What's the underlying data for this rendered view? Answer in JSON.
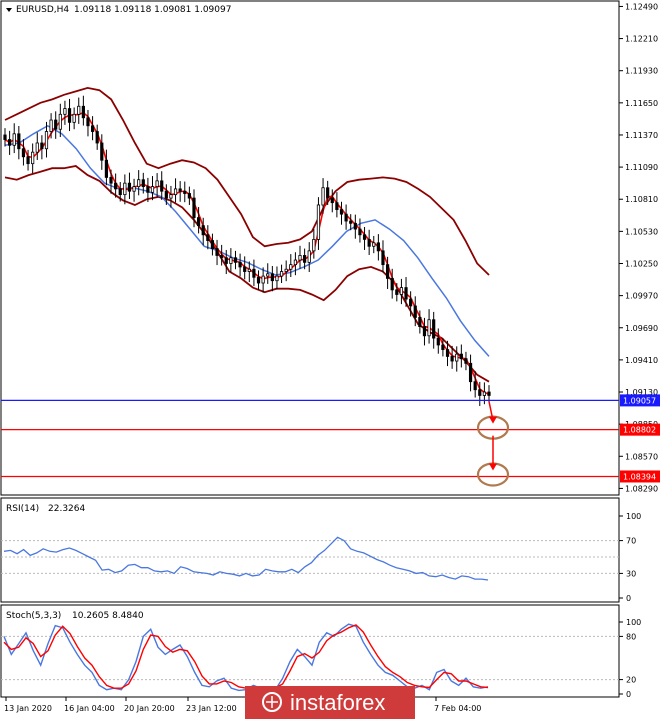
{
  "header": {
    "symbol": "EURUSD,H4",
    "ohlc": "1.09118 1.09118 1.09081 1.09097"
  },
  "chart_data": [
    {
      "type": "candlestick",
      "name": "price",
      "ylim": [
        1.0825,
        1.1252
      ],
      "y_ticks": [
        "1.12490",
        "1.12210",
        "1.11930",
        "1.11650",
        "1.11370",
        "1.11090",
        "1.10810",
        "1.10530",
        "1.10250",
        "1.09970",
        "1.09690",
        "1.09410",
        "1.09130",
        "1.08850",
        "1.08570",
        "1.08290"
      ],
      "y_tick_values": [
        1.1249,
        1.1221,
        1.1193,
        1.1165,
        1.1137,
        1.1109,
        1.1081,
        1.1053,
        1.1025,
        1.0997,
        1.0969,
        1.0941,
        1.0913,
        1.0885,
        1.0857,
        1.0829
      ],
      "close": [
        1.1133,
        1.1128,
        1.1138,
        1.1125,
        1.1118,
        1.1112,
        1.1122,
        1.113,
        1.1125,
        1.114,
        1.115,
        1.1142,
        1.1155,
        1.116,
        1.1148,
        1.1155,
        1.1162,
        1.1152,
        1.1145,
        1.114,
        1.113,
        1.1115,
        1.11,
        1.1095,
        1.109,
        1.1085,
        1.1095,
        1.1088,
        1.1092,
        1.1098,
        1.1092,
        1.1087,
        1.1092,
        1.1097,
        1.1088,
        1.1082,
        1.1085,
        1.109,
        1.1088,
        1.1086,
        1.1082,
        1.1065,
        1.1058,
        1.105,
        1.1045,
        1.1038,
        1.1032,
        1.103,
        1.1025,
        1.103,
        1.1026,
        1.1022,
        1.1018,
        1.102,
        1.1013,
        1.1008,
        1.1014,
        1.1016,
        1.101,
        1.1014,
        1.1018,
        1.102,
        1.1024,
        1.1028,
        1.1032,
        1.1026,
        1.1036,
        1.1046,
        1.1076,
        1.1091,
        1.1082,
        1.1078,
        1.1072,
        1.1068,
        1.1062,
        1.106,
        1.1055,
        1.105,
        1.1046,
        1.104,
        1.1043,
        1.1036,
        1.1024,
        1.1012,
        1.1002,
        1.0998,
        1.1004,
        1.0994,
        1.0988,
        1.0978,
        1.097,
        1.0962,
        1.0976,
        1.096,
        1.0954,
        1.095,
        1.0944,
        1.094,
        1.0946,
        1.0942,
        1.0938,
        1.0922,
        1.0915,
        1.091,
        1.0913,
        1.091
      ],
      "bollinger_upper": [
        1.115,
        1.1155,
        1.116,
        1.1165,
        1.1168,
        1.1172,
        1.1175,
        1.1178,
        1.1176,
        1.1168,
        1.115,
        1.113,
        1.1112,
        1.1108,
        1.1112,
        1.1115,
        1.1113,
        1.1108,
        1.1098,
        1.1083,
        1.1068,
        1.1048,
        1.104,
        1.1042,
        1.1043,
        1.1046,
        1.1053,
        1.1074,
        1.1088,
        1.1096,
        1.1098,
        1.1099,
        1.11,
        1.1099,
        1.1096,
        1.109,
        1.1083,
        1.1073,
        1.1063,
        1.1045,
        1.1025,
        1.1015
      ],
      "bollinger_lower": [
        1.11,
        1.1098,
        1.1102,
        1.1105,
        1.1108,
        1.1108,
        1.111,
        1.1102,
        1.1097,
        1.1087,
        1.108,
        1.1076,
        1.1081,
        1.1083,
        1.108,
        1.1074,
        1.1063,
        1.105,
        1.1035,
        1.1018,
        1.1012,
        1.1004,
        1.1,
        1.1003,
        1.1003,
        1.1002,
        1.0998,
        1.0993,
        1.1002,
        1.1014,
        1.102,
        1.1022,
        1.1018,
        1.1008,
        1.099,
        1.0972,
        1.0965,
        1.096,
        1.095,
        1.094,
        1.0928,
        1.0922
      ],
      "blue_ma": [
        1.1128,
        1.113,
        1.1138,
        1.1145,
        1.1138,
        1.1125,
        1.1108,
        1.1095,
        1.109,
        1.1091,
        1.1088,
        1.1083,
        1.107,
        1.1055,
        1.104,
        1.1036,
        1.103,
        1.1026,
        1.102,
        1.1015,
        1.1017,
        1.1022,
        1.1028,
        1.104,
        1.1053,
        1.106,
        1.1063,
        1.1055,
        1.1045,
        1.103,
        1.1012,
        1.0995,
        1.0975,
        1.0958,
        1.0944
      ]
    },
    {
      "type": "line",
      "name": "RSI(14)",
      "value_label": "22.3264",
      "ylim": [
        0,
        100
      ],
      "y_ticks": [
        "100",
        "70",
        "30",
        "0"
      ],
      "y_tick_values": [
        100,
        70,
        30,
        0
      ],
      "values": [
        57,
        58,
        54,
        59,
        52,
        55,
        60,
        57,
        56,
        59,
        61,
        58,
        54,
        50,
        46,
        34,
        35,
        31,
        33,
        40,
        41,
        37,
        37,
        33,
        32,
        33,
        30,
        38,
        36,
        32,
        31,
        30,
        28,
        32,
        30,
        29,
        27,
        30,
        27,
        28,
        35,
        33,
        32,
        32,
        35,
        31,
        38,
        43,
        52,
        58,
        66,
        74,
        70,
        60,
        57,
        55,
        51,
        47,
        44,
        40,
        37,
        35,
        33,
        30,
        31,
        27,
        26,
        28,
        25,
        23,
        27,
        26,
        23,
        23,
        22
      ]
    },
    {
      "type": "line",
      "name": "Stoch(5,3,3)",
      "value_label": "10.2605 8.4840",
      "ylim": [
        0,
        100
      ],
      "y_ticks": [
        "100",
        "80",
        "20",
        "0"
      ],
      "y_tick_values": [
        100,
        80,
        20,
        0
      ],
      "k": [
        80,
        55,
        70,
        85,
        60,
        40,
        70,
        95,
        92,
        72,
        55,
        40,
        30,
        12,
        6,
        8,
        6,
        20,
        45,
        80,
        90,
        65,
        55,
        62,
        68,
        52,
        30,
        12,
        10,
        18,
        22,
        8,
        5,
        6,
        12,
        8,
        10,
        6,
        22,
        45,
        62,
        52,
        40,
        72,
        85,
        80,
        90,
        97,
        94,
        72,
        55,
        40,
        30,
        26,
        18,
        10,
        8,
        12,
        6,
        30,
        34,
        18,
        12,
        22,
        10,
        8,
        10
      ],
      "d": [
        72,
        62,
        65,
        78,
        70,
        52,
        60,
        82,
        94,
        84,
        66,
        50,
        40,
        24,
        12,
        8,
        8,
        14,
        32,
        62,
        82,
        80,
        66,
        58,
        62,
        60,
        45,
        25,
        14,
        14,
        18,
        16,
        10,
        8,
        10,
        10,
        9,
        8,
        14,
        32,
        52,
        56,
        50,
        58,
        74,
        82,
        86,
        92,
        96,
        86,
        68,
        52,
        38,
        30,
        24,
        16,
        12,
        10,
        9,
        20,
        30,
        28,
        18,
        18,
        14,
        10,
        9
      ]
    }
  ],
  "price_lines": [
    {
      "label": "1.09057",
      "color": "#1a1aff",
      "level": 1.09057
    },
    {
      "label": "1.08802",
      "color": "#ff0000",
      "level": 1.08802
    },
    {
      "label": "1.08394",
      "color": "#ff0000",
      "level": 1.08394
    }
  ],
  "x_labels": [
    "13 Jan 2020",
    "16 Jan 04:00",
    "20 Jan 20:00",
    "23 Jan 12:00",
    "",
    "",
    "",
    "7 Feb 04:00"
  ],
  "watermark": "instaforex",
  "colors": {
    "band": "#8b0000",
    "red_ma": "#ff0000",
    "blue_ma": "#4a78e0",
    "candle": "#000000",
    "rsi": "#4a78e0",
    "stoch_k": "#4a78e0",
    "stoch_d": "#ff0000",
    "ellipse": "#b07a50",
    "grid_level": "#b9b9b9",
    "watermark_bg": "#cf3a3a"
  }
}
